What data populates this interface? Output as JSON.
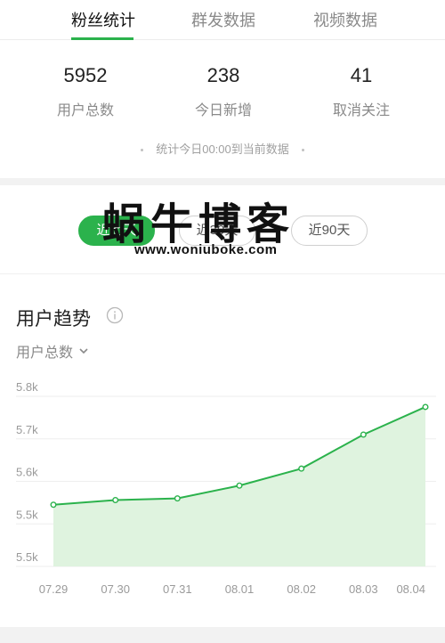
{
  "tabs": [
    {
      "label": "粉丝统计",
      "active": true
    },
    {
      "label": "群发数据",
      "active": false
    },
    {
      "label": "视频数据",
      "active": false
    }
  ],
  "stats": [
    {
      "value": "5952",
      "label": "用户总数"
    },
    {
      "value": "238",
      "label": "今日新增"
    },
    {
      "value": "41",
      "label": "取消关注"
    }
  ],
  "stats_note": "统计今日00:00到当前数据",
  "range_buttons": [
    {
      "label": "近七天",
      "active": true
    },
    {
      "label": "近30天",
      "active": false
    },
    {
      "label": "近90天",
      "active": false
    }
  ],
  "watermark": {
    "title": "蜗牛博客",
    "url": "www.woniuboke.com"
  },
  "trend": {
    "title": "用户趋势",
    "metric_label": "用户总数",
    "info_icon": "info-circle-icon",
    "chevron_icon": "chevron-down-icon"
  },
  "colors": {
    "accent": "#2bb24c",
    "area_fill": "#dff3df"
  },
  "chart_data": {
    "type": "area",
    "categories": [
      "07.29",
      "07.30",
      "07.31",
      "08.01",
      "08.02",
      "08.03",
      "08.04"
    ],
    "series": [
      {
        "values": [
          5545,
          5556,
          5560,
          5590,
          5630,
          5710,
          5775
        ]
      }
    ],
    "y_ticks": [
      {
        "value": 5800,
        "label": "5.8k"
      },
      {
        "value": 5700,
        "label": "5.7k"
      },
      {
        "value": 5600,
        "label": "5.6k"
      },
      {
        "value": 5500,
        "label": "5.5k"
      },
      {
        "value": 5400,
        "label": "5.5k"
      }
    ],
    "ylim": [
      5400,
      5800
    ],
    "grid": true
  }
}
